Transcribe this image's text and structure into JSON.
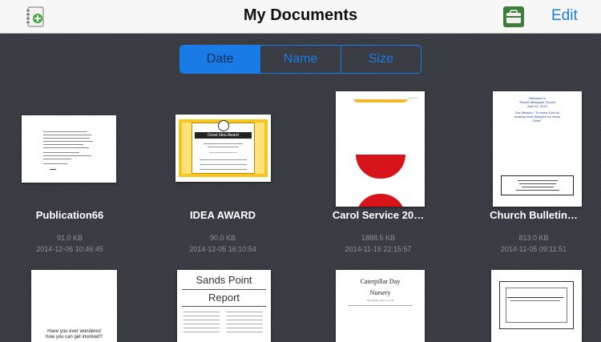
{
  "nav": {
    "title": "My Documents",
    "edit_label": "Edit",
    "left_icon": "new-document-icon",
    "right_icon": "briefcase-icon"
  },
  "sort": {
    "options": [
      "Date",
      "Name",
      "Size"
    ],
    "selected": "Date"
  },
  "documents": [
    {
      "name": "Publication66",
      "size": "91.0 KB",
      "date": "2014-12-06 10:46:45"
    },
    {
      "name": "IDEA AWARD",
      "size": "90.0 KB",
      "date": "2014-12-05 16:10:54"
    },
    {
      "name": "Carol Service 20…",
      "size": "1888.5 KB",
      "date": "2014-11-16 22:15:57"
    },
    {
      "name": "Church Bulletin…",
      "size": "813.0 KB",
      "date": "2014-11-05 09:11:51"
    }
  ],
  "thumb_text": {
    "award_banner": "Great Idea Award",
    "bulletin_lines": [
      "Welcome to",
      "Temple Mosaique Church",
      "April 31, 2013",
      "Our Mission: \"To honor God by",
      "making more disciples for Jesus",
      "Christ.\""
    ],
    "sands_title_1": "Sands Point",
    "sands_title_2": "Report",
    "caterpillar_1": "Caterpillar Day",
    "caterpillar_2": "Nursery",
    "nursery_sub": "Our Nursery April 15, 2 pm",
    "row2_text_1": "Have you ever wondered",
    "row2_text_2": "how you can get involved?"
  },
  "colors": {
    "accent": "#1a7ae6",
    "award_yellow": "#f6c51e",
    "carol_red": "#d7141a"
  }
}
